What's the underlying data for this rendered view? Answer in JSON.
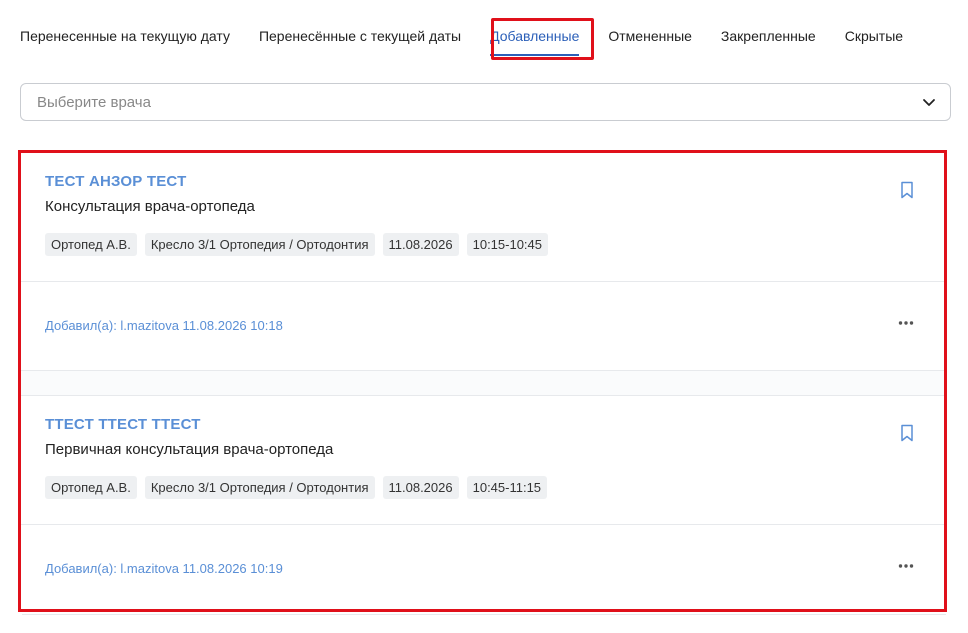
{
  "tabs": [
    {
      "label": "Перенесенные на текущую дату",
      "active": false
    },
    {
      "label": "Перенесённые с текущей даты",
      "active": false
    },
    {
      "label": "Добавленные",
      "active": true
    },
    {
      "label": "Отмененные",
      "active": false
    },
    {
      "label": "Закрепленные",
      "active": false
    },
    {
      "label": "Скрытые",
      "active": false
    }
  ],
  "doctor_select": {
    "placeholder": "Выберите врача"
  },
  "cards": [
    {
      "patient": "ТЕСТ АНЗОР ТЕСТ",
      "service": "Консультация врача-ортопеда",
      "chips": [
        "Ортопед А.В.",
        "Кресло 3/1 Ортопедия / Ортодонтия",
        "11.08.2026",
        "10:15-10:45"
      ],
      "added": "Добавил(а): l.mazitova 11.08.2026 10:18"
    },
    {
      "patient": "ТТЕСТ ТТЕСТ ТТЕСТ",
      "service": "Первичная консультация врача-ортопеда",
      "chips": [
        "Ортопед А.В.",
        "Кресло 3/1 Ортопедия / Ортодонтия",
        "11.08.2026",
        "10:45-11:15"
      ],
      "added": "Добавил(а): l.mazitova 11.08.2026 10:19"
    }
  ],
  "colors": {
    "accent": "#2b5fb8",
    "link": "#5a8fd6",
    "highlight": "#e0101a"
  }
}
